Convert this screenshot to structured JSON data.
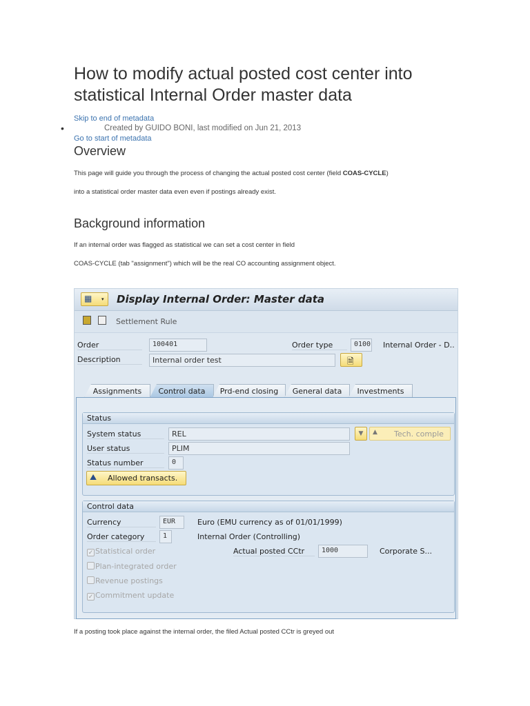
{
  "title": "How to modify actual posted cost center into statistical Internal Order master data",
  "links": {
    "skip_end": "Skip to end of metadata",
    "go_start": "Go to start of metadata"
  },
  "meta": "Created by GUIDO BONI, last modified on Jun 21, 2013",
  "overview": {
    "heading": "Overview",
    "p1_pre": "This page will guide you through the process of changing the actual posted cost center (field ",
    "p1_bold": "COAS-CYCLE",
    "p1_post": ")",
    "p2": "into a statistical order master data even even if postings already exist."
  },
  "background": {
    "heading": "Background information",
    "p1": "If an internal order was flagged as statistical we can set a cost center in field",
    "p2": "COAS-CYCLE (tab \"assignment\") which will be the real CO accounting assignment  object."
  },
  "sap": {
    "window_title": "Display Internal Order: Master data",
    "toolbar": {
      "settlement_rule": "Settlement Rule"
    },
    "header": {
      "order_label": "Order",
      "order_value": "100401",
      "order_type_label": "Order type",
      "order_type_value": "0100",
      "order_type_text": "Internal Order - D..",
      "description_label": "Description",
      "description_value": "Internal order test"
    },
    "tabs": [
      {
        "label": "Assignments"
      },
      {
        "label": "Control data",
        "active": true
      },
      {
        "label": "Prd-end closing"
      },
      {
        "label": "General data"
      },
      {
        "label": "Investments"
      }
    ],
    "status": {
      "title": "Status",
      "system_status_label": "System status",
      "system_status": "REL",
      "tech_complete": "Tech. comple",
      "user_status_label": "User status",
      "user_status": "PLIM",
      "status_number_label": "Status number",
      "status_number": "0",
      "allowed_transactions": "Allowed transacts."
    },
    "control": {
      "title": "Control data",
      "currency_label": "Currency",
      "currency": "EUR",
      "currency_text": "Euro (EMU currency as of 01/01/1999)",
      "order_category_label": "Order category",
      "order_category": "1",
      "order_category_text": "Internal Order (Controlling)",
      "actual_cctr_label": "Actual posted CCtr",
      "actual_cctr": "1000",
      "actual_cctr_text": "Corporate S...",
      "checkboxes": [
        {
          "label": "Statistical order",
          "checked": true
        },
        {
          "label": "Plan-integrated order",
          "checked": false
        },
        {
          "label": "Revenue postings",
          "checked": false
        },
        {
          "label": "Commitment update",
          "checked": true
        }
      ]
    }
  },
  "footer": "If a posting took place against the internal order, the filed Actual posted CCtr is greyed out"
}
